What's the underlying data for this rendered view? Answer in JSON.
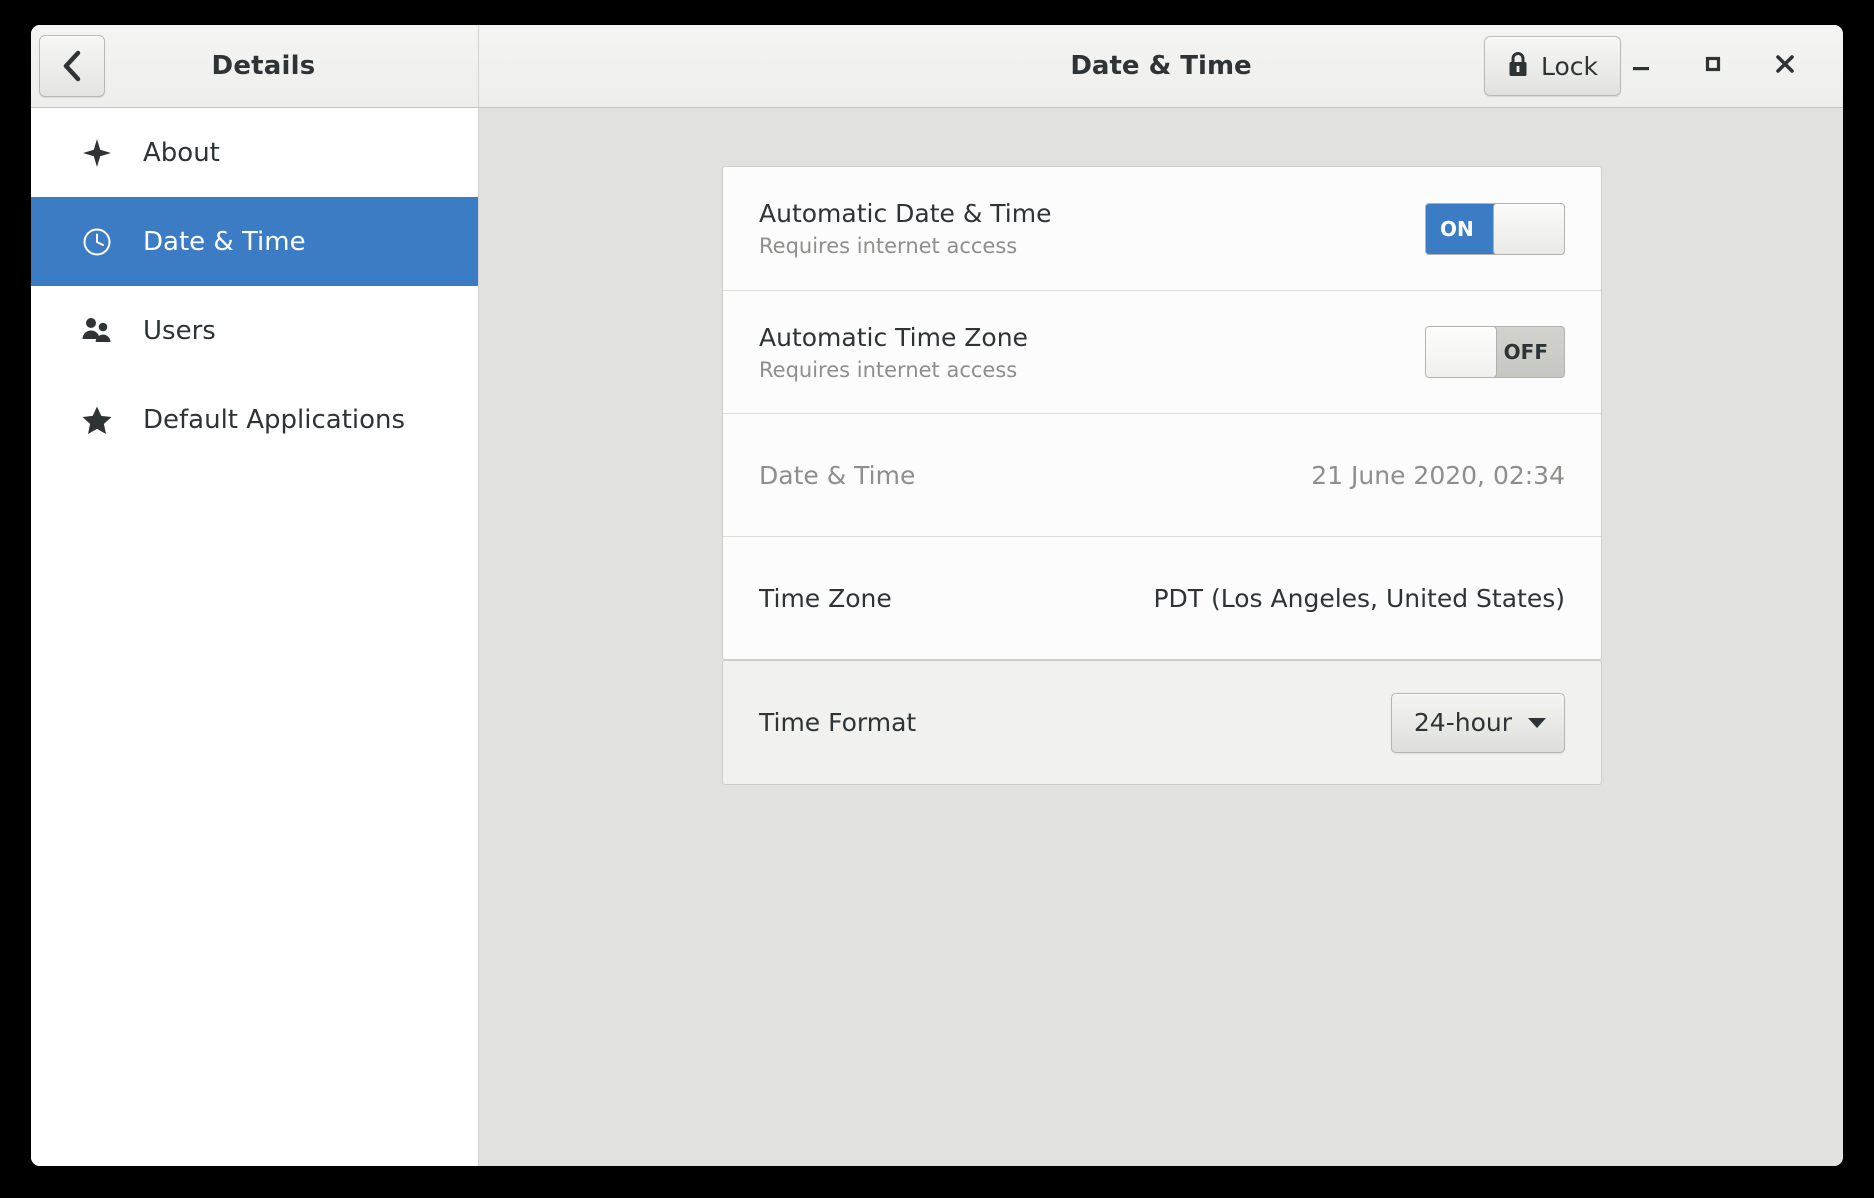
{
  "window": {
    "left_title": "Details",
    "right_title": "Date & Time",
    "back_icon": "chevron-left-icon",
    "lock": {
      "label": "Lock",
      "icon": "lock-icon"
    },
    "controls": [
      {
        "name": "minimize",
        "icon": "minimize-icon"
      },
      {
        "name": "maximize",
        "icon": "maximize-icon"
      },
      {
        "name": "close",
        "icon": "close-icon"
      }
    ]
  },
  "sidebar": {
    "items": [
      {
        "label": "About",
        "icon": "sparkle-icon",
        "selected": false
      },
      {
        "label": "Date & Time",
        "icon": "clock-icon",
        "selected": true
      },
      {
        "label": "Users",
        "icon": "users-icon",
        "selected": false
      },
      {
        "label": "Default Applications",
        "icon": "star-icon",
        "selected": false
      }
    ]
  },
  "main": {
    "settings_card": {
      "rows": [
        {
          "title": "Automatic Date & Time",
          "subtitle": "Requires internet access",
          "switch": {
            "state": "ON",
            "label": "ON"
          }
        },
        {
          "title": "Automatic Time Zone",
          "subtitle": "Requires internet access",
          "switch": {
            "state": "OFF",
            "label": "OFF"
          }
        },
        {
          "title": "Date & Time",
          "value": "21 June 2020, 02:34",
          "dim": true
        },
        {
          "title": "Time Zone",
          "value": "PDT (Los Angeles, United States)",
          "dim": false
        }
      ]
    },
    "format_card": {
      "title": "Time Format",
      "dropdown": {
        "value": "24-hour",
        "icon": "caret-down-icon"
      }
    }
  },
  "colors": {
    "accent": "#3b7cc4",
    "window_bg": "#e1e1df",
    "card_bg": "#fcfcfc",
    "header_bg": "#eeeeec",
    "text": "#2e3436",
    "dim_text": "#8d8f8c"
  }
}
